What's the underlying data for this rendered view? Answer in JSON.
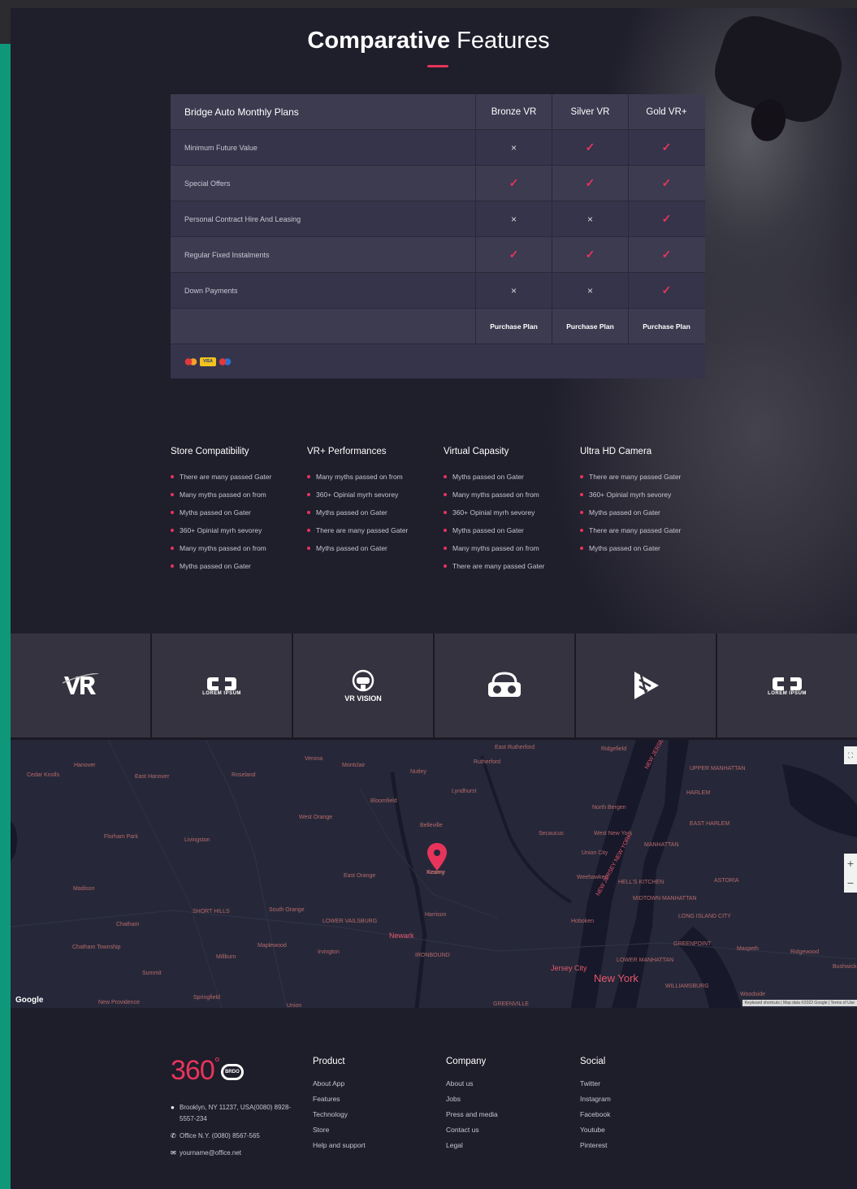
{
  "header": {
    "title_bold": "Comparative",
    "title_light": "Features"
  },
  "pricing_table": {
    "header": [
      "Bridge Auto Monthly Plans",
      "Bronze VR",
      "Silver VR",
      "Gold VR+"
    ],
    "rows": [
      {
        "label": "Minimum Future Value",
        "values": [
          "no",
          "yes",
          "yes"
        ]
      },
      {
        "label": "Special Offers",
        "values": [
          "yes",
          "yes",
          "yes"
        ]
      },
      {
        "label": "Personal Contract Hire And Leasing",
        "values": [
          "no",
          "no",
          "yes"
        ]
      },
      {
        "label": "Regular Fixed Instalments",
        "values": [
          "yes",
          "yes",
          "yes"
        ]
      },
      {
        "label": "Down Payments",
        "values": [
          "no",
          "no",
          "yes"
        ]
      }
    ],
    "purchase_label": "Purchase Plan",
    "yes_symbol": "✓",
    "no_symbol": "×",
    "payment_cards": [
      "mastercard",
      "visa",
      "maestro"
    ],
    "visa_text": "VISA"
  },
  "features": [
    {
      "title": "Store Compatibility",
      "items": [
        "There are many passed Gater",
        "Many myths passed on from",
        "Myths passed on Gater",
        "360+ Opinial myrh sevorey",
        "Many myths passed on from",
        "Myths passed on Gater"
      ]
    },
    {
      "title": "VR+ Performances",
      "items": [
        "Many myths passed on from",
        "360+ Opinial myrh sevorey",
        "Myths passed on Gater",
        "There are many passed Gater",
        "Myths passed on Gater"
      ]
    },
    {
      "title": "Virtual Capasity",
      "items": [
        "Myths passed on Gater",
        "Many myths passed on from",
        "360+ Opinial myrh sevorey",
        "Myths passed on Gater",
        "Many myths passed on from",
        "There are many passed Gater"
      ]
    },
    {
      "title": "Ultra HD Camera",
      "items": [
        "There are many passed Gater",
        "360+ Opinial myrh sevorey",
        "Myths passed on Gater",
        "There are many passed Gater",
        "Myths passed on Gater"
      ]
    }
  ],
  "partner_logos": [
    {
      "icon": "vr-logo-icon",
      "text": "VR",
      "sub": ""
    },
    {
      "icon": "lorem-ipsum-logo-icon",
      "text": "",
      "sub": "LOREM IPSUM"
    },
    {
      "icon": "vr-vision-logo-icon",
      "text": "",
      "sub": "VR VISION"
    },
    {
      "icon": "vr-headset-logo-icon",
      "text": "",
      "sub": ""
    },
    {
      "icon": "play-cube-logo-icon",
      "text": "",
      "sub": ""
    },
    {
      "icon": "lorem-ipsum-logo-icon",
      "text": "",
      "sub": "LOREM IPSUM"
    }
  ],
  "map": {
    "labels": [
      "Hanover",
      "East Hanover",
      "Roseland",
      "Verona",
      "Montclair",
      "Nutley",
      "East Rutherford",
      "Rutherford",
      "Ridgefield",
      "NEW JERSEY NEW YORK",
      "UPPER MANHATTAN",
      "HARLEM",
      "Lyndhurst",
      "North Bergen",
      "Bloomfield",
      "West Orange",
      "Belleville",
      "Florham Park",
      "Livingston",
      "Secaucus",
      "West New York",
      "Union City",
      "MANHATTAN",
      "EAST HARLEM",
      "Kearny",
      "East Orange",
      "Weehawken",
      "HELL'S KITCHEN",
      "ASTORIA",
      "Madison",
      "SHORT HILLS",
      "South Orange",
      "Harrison",
      "MIDTOWN MANHATTAN",
      "LONG ISLAND CITY",
      "Chatham",
      "LOWER VAILSBURG",
      "Hoboken",
      "NEW JERSEY NEW YORK",
      "Newark",
      "GREENPOINT",
      "Chatham Township",
      "Maplewood",
      "Irvington",
      "Millburn",
      "IRONBOUND",
      "LOWER MANHATTAN",
      "Jersey City",
      "New York",
      "Summit",
      "Springfield",
      "WILLIAMSBURG",
      "Union",
      "New Providence",
      "GREENVILLE",
      "Woodside",
      "Maspeth",
      "Ridgewood",
      "Bushwick",
      "Cedar Knolls"
    ],
    "marker_label": "Kearny",
    "google": "Google",
    "terms": "Keyboard shortcuts | Map data ©2022 Google | Terms of Use",
    "zoom_in": "+",
    "zoom_out": "−",
    "fullscreen": "⛶"
  },
  "footer": {
    "brand_main": "360",
    "brand_deg": "°",
    "brand_badge": "BRDO",
    "address": "Brooklyn, NY 11237, USA(0080) 8928-5557-234",
    "phone": "Office N.Y. (0080) 8567-565",
    "email": "yourname@office.net",
    "columns": [
      {
        "title": "Product",
        "links": [
          "About App",
          "Features",
          "Technology",
          "Store",
          "Help and support"
        ]
      },
      {
        "title": "Company",
        "links": [
          "About us",
          "Jobs",
          "Press and media",
          "Contact us",
          "Legal"
        ]
      },
      {
        "title": "Social",
        "links": [
          "Twitter",
          "Instagram",
          "Facebook",
          "Youtube",
          "Pinterest"
        ]
      }
    ]
  }
}
